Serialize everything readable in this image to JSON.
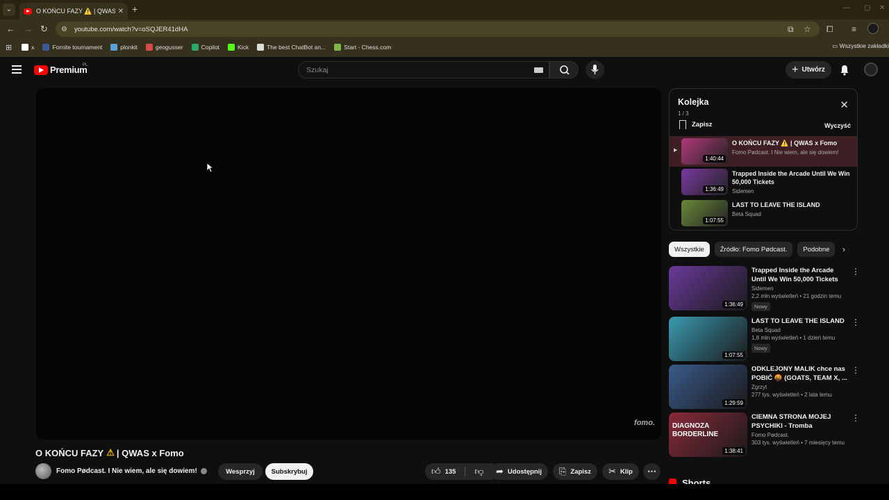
{
  "browser": {
    "tab_title": "O KOŃCU FAZY ⚠️ | QWAS x Fomo",
    "url": "youtube.com/watch?v=oSQJER41dHA",
    "bookmarks": [
      {
        "label": "x",
        "icon": "x-icon",
        "color": "#ffffff"
      },
      {
        "label": "Fornite tournament",
        "icon": "gamepad-icon",
        "color": "#3b5998"
      },
      {
        "label": "plonkit",
        "icon": "globe-icon",
        "color": "#5aa0d8"
      },
      {
        "label": "geogusser",
        "icon": "pin-icon",
        "color": "#d84a4a"
      },
      {
        "label": "Copilot",
        "icon": "copilot-icon",
        "color": "#2aa867"
      },
      {
        "label": "Kick",
        "icon": "kick-icon",
        "color": "#53fc18"
      },
      {
        "label": "The best ChatBot an...",
        "icon": "diamond-icon",
        "color": "#dddddd"
      },
      {
        "label": "Start - Chess.com",
        "icon": "pawn-icon",
        "color": "#81b64c"
      }
    ],
    "all_bookmarks": "Wszystkie zakładki"
  },
  "header": {
    "logo": "Premium",
    "region": "PL",
    "search_placeholder": "Szukaj",
    "create_label": "Utwórz"
  },
  "video": {
    "title_pre": "O KOŃCU FAZY",
    "title_post": "| QWAS x Fomo",
    "watermark": "fomo.",
    "channel": "Fomo Pødcast. I Nie wiem, ale się dowiem!",
    "support_label": "Wesprzyj",
    "subscribe_label": "Subskrybuj",
    "likes": "135",
    "share_label": "Udostępnij",
    "save_label": "Zapisz",
    "clip_label": "Klip"
  },
  "queue": {
    "title": "Kolejka",
    "count": "1 / 3",
    "save_label": "Zapisz",
    "clear_label": "Wyczyść",
    "items": [
      {
        "title": "O KOŃCU FAZY ⚠️ | QWAS x Fomo",
        "channel": "Fomo Pødcast. I Nie wiem, ale się dowiem!",
        "duration": "1:40:44",
        "thumb": "#b03a7a"
      },
      {
        "title": "Trapped Inside the Arcade Until We Win 50,000 Tickets",
        "channel": "Sidemen",
        "duration": "1:36:49",
        "thumb": "#7a3aa0"
      },
      {
        "title": "LAST TO LEAVE THE ISLAND",
        "channel": "Beta Squad",
        "duration": "1:07:55",
        "thumb": "#6a8a3a"
      }
    ]
  },
  "chips": [
    "Wszystkie",
    "Źródło: Fomo Pødcast.",
    "Podobne"
  ],
  "recommendations": [
    {
      "title": "Trapped Inside the Arcade Until We Win 50,000 Tickets",
      "channel": "Sidemen",
      "meta": "2,2 mln wyświetleń • 21 godzin temu",
      "badge": "Nowy",
      "duration": "1:36:49",
      "thumb": "#6a3a9a"
    },
    {
      "title": "LAST TO LEAVE THE ISLAND",
      "channel": "Beta Squad",
      "meta": "1,8 mln wyświetleń • 1 dzień temu",
      "badge": "Nowy",
      "duration": "1:07:55",
      "thumb": "#3a9ab0"
    },
    {
      "title": "ODKLEJONY MALIK chce nas POBIĆ 🤬 (GOATS, TEAM X, ...",
      "channel": "Zgrzyt",
      "meta": "277 tys. wyświetleń • 2 lata temu",
      "badge": "",
      "duration": "1:29:59",
      "thumb": "#3a5a8a"
    },
    {
      "title": "CIEMNA STRONA MOJEJ PSYCHIKI - Tromba",
      "channel": "Fomo Pødcast.",
      "meta": "303 tys. wyświetleń • 7 miesięcy temu",
      "badge": "",
      "duration": "1:38:41",
      "thumb": "#8a2a3a",
      "thumb_text": "DIAGNOZA BORDERLINE"
    }
  ],
  "shorts_label": "Shorts"
}
